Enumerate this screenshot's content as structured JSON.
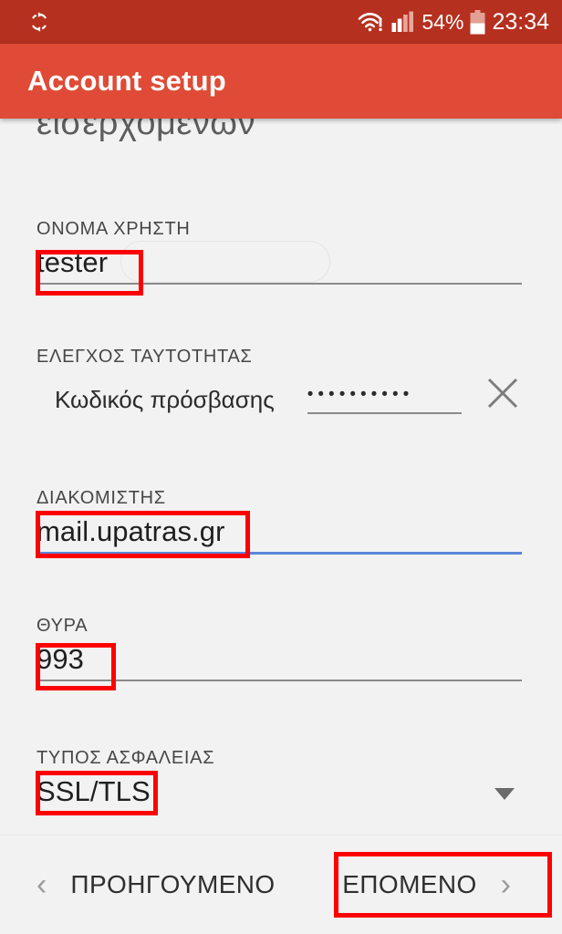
{
  "statusbar": {
    "sync_icon": "sync-icon",
    "wifi_icon": "wifi-no-internet-icon",
    "signal_icon": "cellular-signal-icon",
    "battery_percent": "54%",
    "battery_icon": "battery-icon",
    "clock": "23:34"
  },
  "appbar": {
    "title": "Account setup"
  },
  "content": {
    "cut_off_text": "εισερχομένων",
    "fields": {
      "username": {
        "label": "ΟΝΟΜΑ ΧΡΗΣΤΗ",
        "value": "tester"
      },
      "authentication": {
        "label": "ΕΛΕΓΧΟΣ ΤΑΥΤΟΤΗΤΑΣ",
        "caption": "Κωδικός πρόσβασης",
        "value": "••••••••••",
        "clear_icon": "clear-x-icon"
      },
      "server": {
        "label": "ΔΙΑΚΟΜΙΣΤΗΣ",
        "value": "mail.upatras.gr"
      },
      "port": {
        "label": "ΘΥΡΑ",
        "value": "993"
      },
      "security_type": {
        "label": "ΤΥΠΟΣ ΑΣΦΑΛΕΙΑΣ",
        "value": "SSL/TLS",
        "caret_icon": "chevron-down-icon"
      }
    }
  },
  "navbar": {
    "previous": {
      "label": "ΠΡΟΗΓΟΥΜΕΝΟ",
      "chevron": "‹"
    },
    "next": {
      "label": "ΕΠΟΜΕΝΟ",
      "chevron": "›"
    }
  },
  "colors": {
    "statusbar": "#b5301f",
    "appbar": "#df4b36",
    "background": "#f2f2f2",
    "annotation": "#ff0000",
    "focused_underline": "#5b87da"
  }
}
